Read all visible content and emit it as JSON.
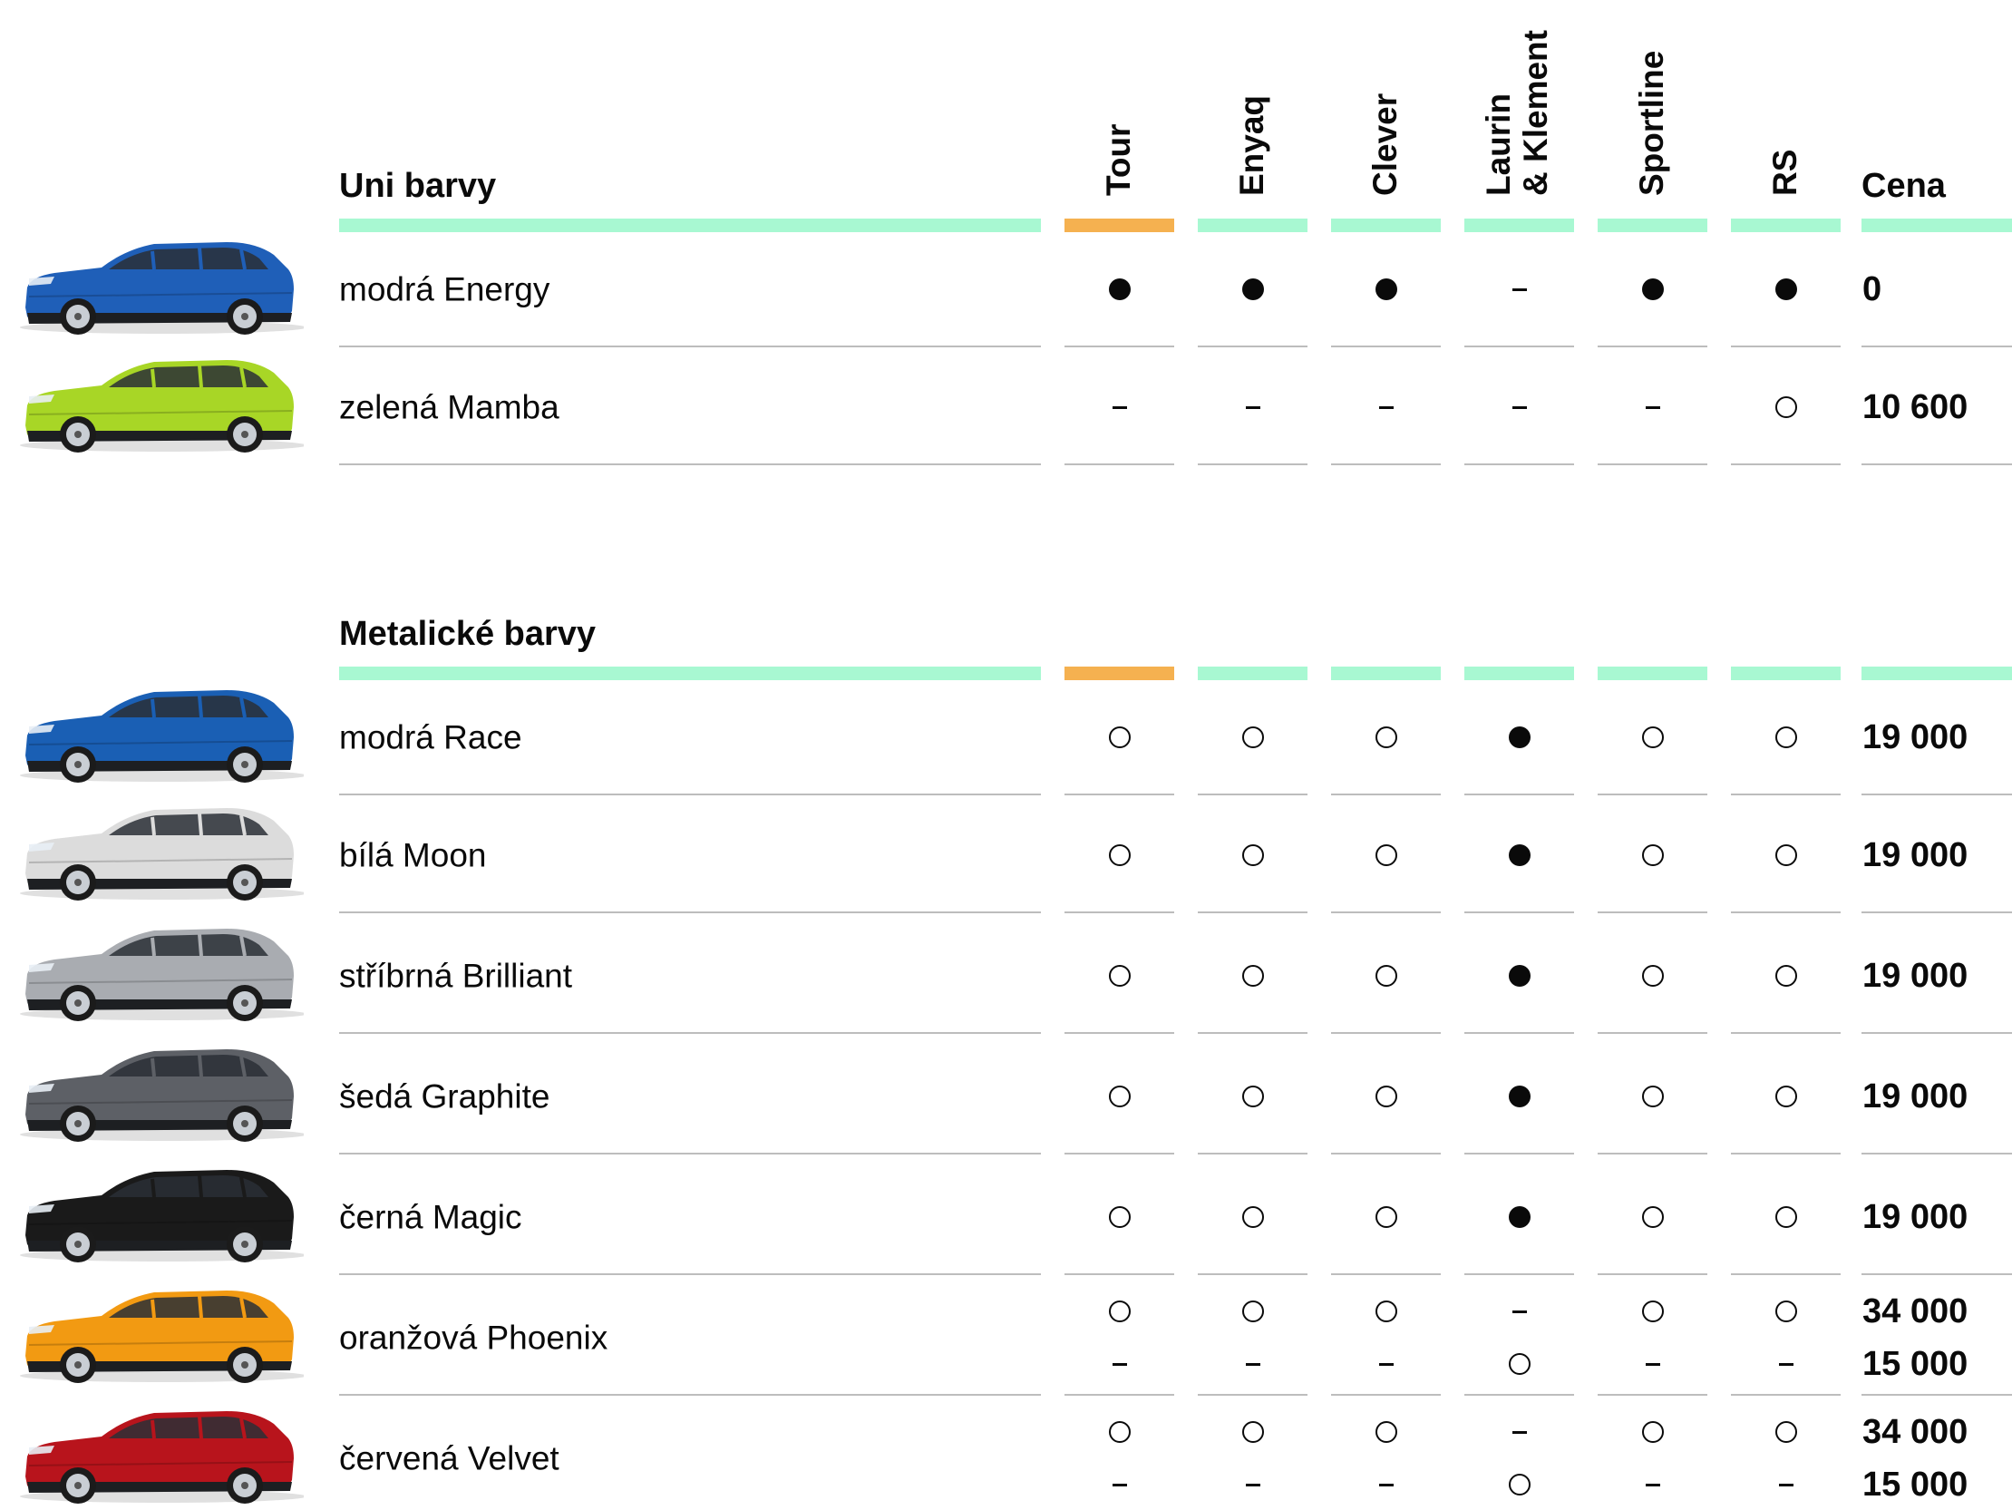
{
  "columns": [
    "Tour",
    "Enyaq",
    "Clever",
    "Laurin & Klement",
    "Sportline",
    "RS"
  ],
  "price_header": "Cena",
  "sections": [
    {
      "title": "Uni barvy",
      "rows": [
        {
          "name": "modrá Energy",
          "car_color": "#1f5fb8",
          "lines": [
            {
              "marks": [
                "full",
                "full",
                "full",
                "dash",
                "full",
                "full"
              ],
              "price": "0"
            }
          ]
        },
        {
          "name": "zelená Mamba",
          "car_color": "#a8d626",
          "lines": [
            {
              "marks": [
                "dash",
                "dash",
                "dash",
                "dash",
                "dash",
                "empty"
              ],
              "price": "10 600"
            }
          ]
        }
      ]
    },
    {
      "title": "Metalické barvy",
      "rows": [
        {
          "name": "modrá Race",
          "car_color": "#1a5fb4",
          "lines": [
            {
              "marks": [
                "empty",
                "empty",
                "empty",
                "full",
                "empty",
                "empty"
              ],
              "price": "19 000"
            }
          ]
        },
        {
          "name": "bílá Moon",
          "car_color": "#dcdcdc",
          "lines": [
            {
              "marks": [
                "empty",
                "empty",
                "empty",
                "full",
                "empty",
                "empty"
              ],
              "price": "19 000"
            }
          ]
        },
        {
          "name": "stříbrná Brilliant",
          "car_color": "#a9acb1",
          "lines": [
            {
              "marks": [
                "empty",
                "empty",
                "empty",
                "full",
                "empty",
                "empty"
              ],
              "price": "19 000"
            }
          ]
        },
        {
          "name": "šedá Graphite",
          "car_color": "#5d6066",
          "lines": [
            {
              "marks": [
                "empty",
                "empty",
                "empty",
                "full",
                "empty",
                "empty"
              ],
              "price": "19 000"
            }
          ]
        },
        {
          "name": "černá Magic",
          "car_color": "#1a1a1a",
          "lines": [
            {
              "marks": [
                "empty",
                "empty",
                "empty",
                "full",
                "empty",
                "empty"
              ],
              "price": "19 000"
            }
          ]
        },
        {
          "name": "oranžová Phoenix",
          "car_color": "#f29a12",
          "lines": [
            {
              "marks": [
                "empty",
                "empty",
                "empty",
                "dash",
                "empty",
                "empty"
              ],
              "price": "34 000"
            },
            {
              "marks": [
                "dash",
                "dash",
                "dash",
                "empty",
                "dash",
                "dash"
              ],
              "price": "15 000"
            }
          ]
        },
        {
          "name": "červená Velvet",
          "car_color": "#b8141c",
          "lines": [
            {
              "marks": [
                "empty",
                "empty",
                "empty",
                "dash",
                "empty",
                "empty"
              ],
              "price": "34 000"
            },
            {
              "marks": [
                "dash",
                "dash",
                "dash",
                "empty",
                "dash",
                "dash"
              ],
              "price": "15 000"
            }
          ]
        }
      ]
    }
  ],
  "colors": {
    "header_bar": "#a8f8d2",
    "tour_bar": "#f5b150",
    "row_rule": "#bdbdbd"
  }
}
